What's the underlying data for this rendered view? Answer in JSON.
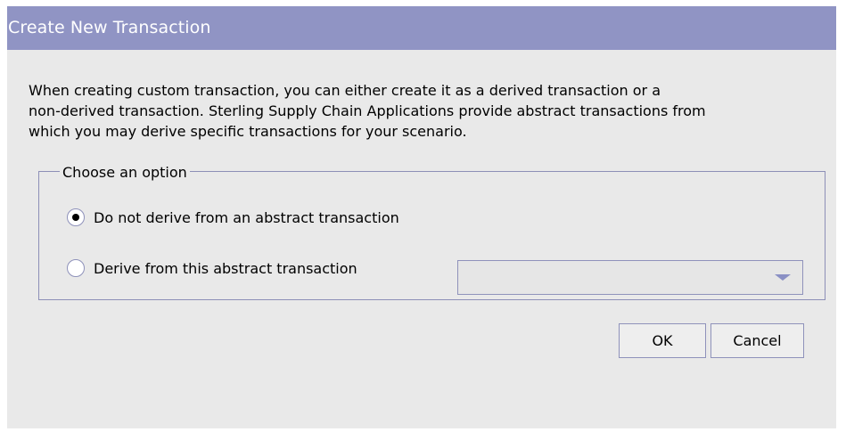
{
  "dialog": {
    "title": "Create New Transaction"
  },
  "description": {
    "lines": [
      "When creating custom transaction, you can either create it as a derived transaction or a",
      "non-derived transaction. Sterling Supply Chain Applications provide abstract transactions from",
      "which you may derive specific transactions for your scenario."
    ]
  },
  "options": {
    "group_label": "Choose an option",
    "items": [
      {
        "label": "Do not derive from an abstract transaction",
        "selected": true
      },
      {
        "label": "Derive from this abstract transaction",
        "selected": false
      }
    ],
    "abstract_transaction_select": {
      "value": "",
      "icon": "chevron-down-icon"
    }
  },
  "buttons": {
    "ok_label": "OK",
    "cancel_label": "Cancel"
  },
  "colors": {
    "titlebar": "#9094c4",
    "dialog_background": "#e9e9e9",
    "border": "#8f92bb",
    "dropdown_arrow": "#8a90c4"
  }
}
